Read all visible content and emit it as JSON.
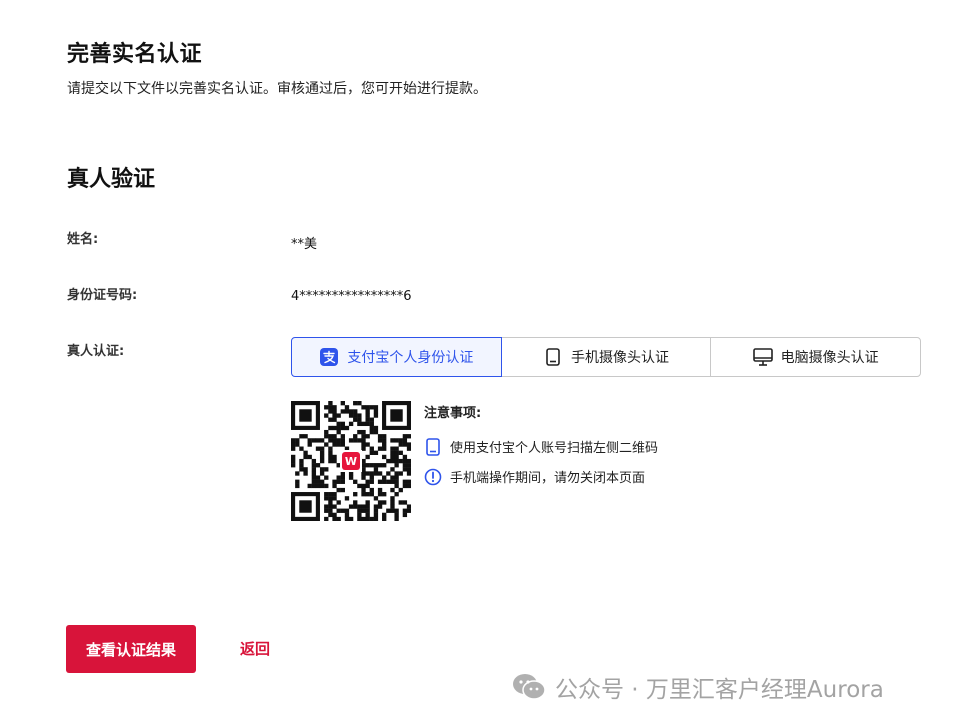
{
  "header": {
    "title": "完善实名认证",
    "subtitle": "请提交以下文件以完善实名认证。审核通过后，您可开始进行提款。"
  },
  "section": {
    "title": "真人验证"
  },
  "fields": {
    "name_label": "姓名:",
    "name_value": "**美",
    "id_label": "身份证号码:",
    "id_value": "4****************6",
    "verify_label": "真人认证:"
  },
  "methods": [
    {
      "label": "支付宝个人身份认证",
      "icon": "alipay-icon",
      "active": true
    },
    {
      "label": "手机摄像头认证",
      "icon": "phone-icon",
      "active": false
    },
    {
      "label": "电脑摄像头认证",
      "icon": "monitor-icon",
      "active": false
    }
  ],
  "qr": {
    "logo_text": "W",
    "logo_color": "#e6163c"
  },
  "notice": {
    "title": "注意事项:",
    "items": [
      {
        "icon": "phone-icon",
        "text": "使用支付宝个人账号扫描左侧二维码"
      },
      {
        "icon": "info-circle-icon",
        "text": "手机端操作期间，请勿关闭本页面"
      }
    ]
  },
  "actions": {
    "primary_label": "查看认证结果",
    "back_label": "返回"
  },
  "watermark": {
    "text": "公众号 · 万里汇客户经理Aurora"
  },
  "colors": {
    "accent": "#d8143a",
    "active_tab": "#2f54eb"
  }
}
